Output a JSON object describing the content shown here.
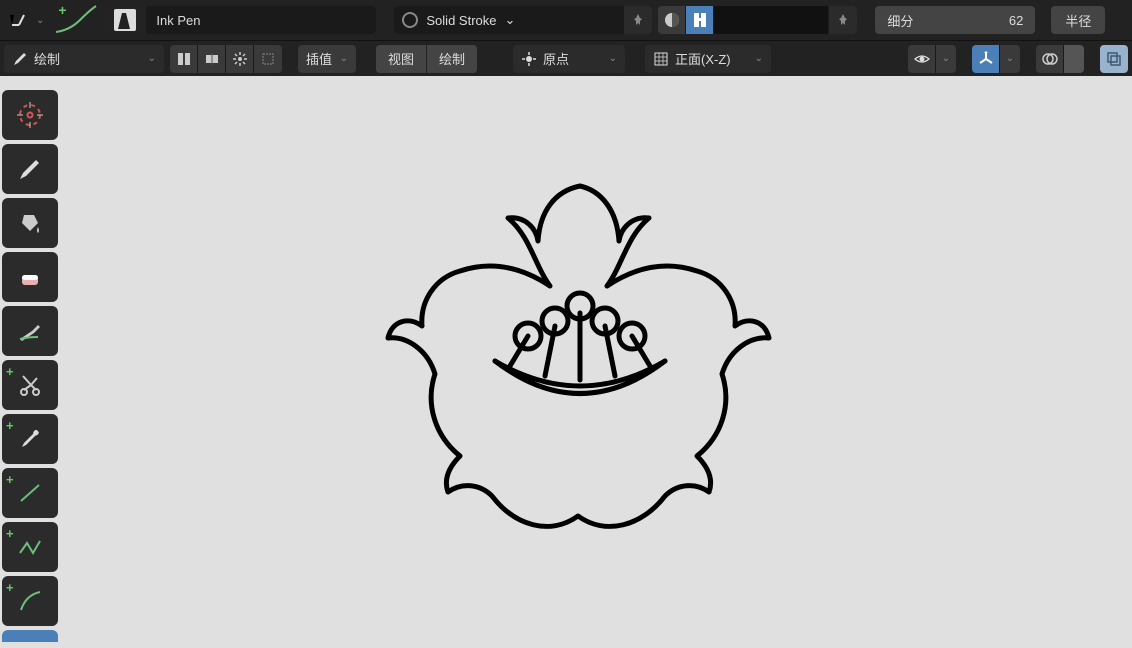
{
  "topbar1": {
    "brush_name": "Ink Pen",
    "material_name": "Solid Stroke",
    "subdiv_label": "细分",
    "subdiv_value": "62",
    "half_label": "半径"
  },
  "topbar2": {
    "mode_label": "绘制",
    "interp_label": "插值",
    "view_label": "视图",
    "draw_label": "绘制",
    "origin_label": "原点",
    "orient_label": "正面(X-Z)"
  },
  "icons": {
    "brush_preset": "brush-preset-icon",
    "stroke_circle": "stroke-circle-icon",
    "pin": "pin-icon"
  }
}
